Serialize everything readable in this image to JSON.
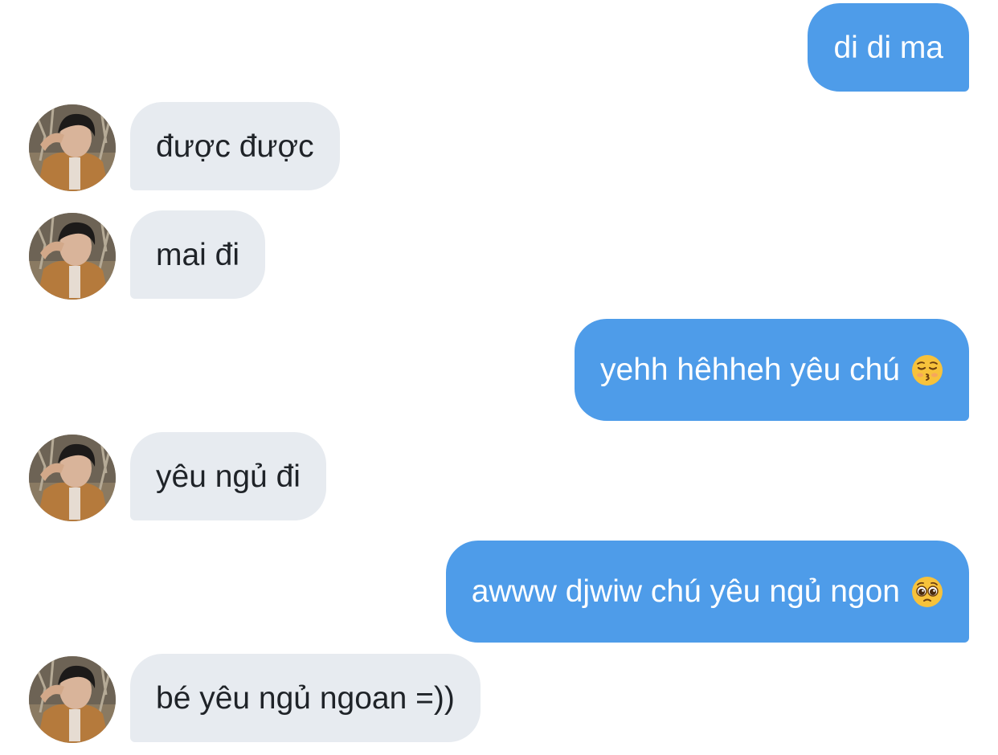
{
  "conversation": {
    "messages": [
      {
        "sender": "me",
        "text": "di di ma"
      },
      {
        "sender": "contact",
        "text": "được được"
      },
      {
        "sender": "contact",
        "text": "mai đi"
      },
      {
        "sender": "me",
        "text": "yehh hêhheh yêu chú",
        "emoji": "kissing-closed-eyes-emoji"
      },
      {
        "sender": "contact",
        "text": "yêu ngủ đi"
      },
      {
        "sender": "me",
        "text": "awww djwiw chú yêu ngủ ngon",
        "emoji": "pleading-face-emoji"
      },
      {
        "sender": "contact",
        "text": "bé yêu ngủ ngoan =))"
      }
    ]
  },
  "colors": {
    "outgoing_bubble": "#4e9ce9",
    "incoming_bubble": "#e7ebf0",
    "outgoing_text": "#ffffff",
    "incoming_text": "#1f2328"
  }
}
